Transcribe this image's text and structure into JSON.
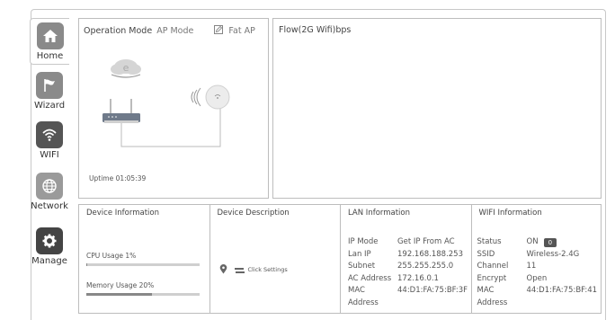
{
  "nav": [
    {
      "label": "Home",
      "icon": "home-icon",
      "active": true
    },
    {
      "label": "Wizard",
      "icon": "flag-icon",
      "active": false
    },
    {
      "label": "WIFI",
      "icon": "wifi-icon",
      "active": false
    },
    {
      "label": "Network",
      "icon": "globe-icon",
      "active": false
    },
    {
      "label": "Manage",
      "icon": "gear-icon",
      "active": false
    }
  ],
  "operation": {
    "label": "Operation Mode",
    "mode": "AP Mode",
    "fat_ap": "Fat AP",
    "uptime": "Uptime 01:05:39"
  },
  "flow": {
    "title": "Flow(2G Wifi)bps"
  },
  "device_info": {
    "title": "Device Information",
    "cpu_label": "CPU Usage   1%",
    "cpu_percent": 1,
    "memory_label": "Memory Usage  20%",
    "memory_percent": 20
  },
  "device_desc": {
    "title": "Device Description",
    "action": "Click Settings"
  },
  "lan": {
    "title": "LAN Information",
    "rows": [
      {
        "k": "IP Mode",
        "v": "Get IP From AC"
      },
      {
        "k": "Lan IP",
        "v": "192.168.188.253"
      },
      {
        "k": "Subnet",
        "v": "255.255.255.0"
      },
      {
        "k": "AC Address",
        "v": "172.16.0.1"
      },
      {
        "k": "MAC Address",
        "v": "44:D1:FA:75:BF:3F"
      }
    ]
  },
  "wifi": {
    "title": "WIFI Information",
    "status_label": "Status",
    "status_value": "ON",
    "status_badge": "0",
    "rows": [
      {
        "k": "SSID",
        "v": "Wireless-2.4G"
      },
      {
        "k": "Channel",
        "v": "11"
      },
      {
        "k": "Encrypt",
        "v": "Open"
      },
      {
        "k": "MAC Address",
        "v": "44:D1:FA:75:BF:41"
      }
    ]
  },
  "colors": {
    "border": "#bdbdbd",
    "icon_bg": "#8a8a8a",
    "accent_dark": "#555555"
  }
}
